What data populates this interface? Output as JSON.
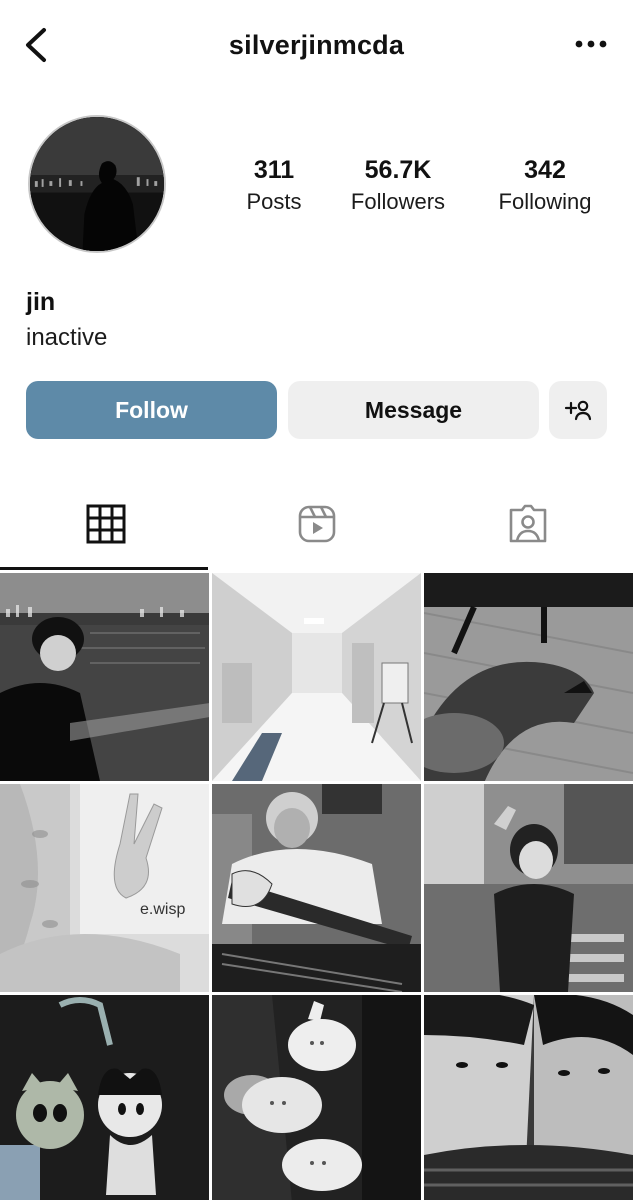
{
  "header": {
    "username": "silverjinmcda",
    "back_icon": "chevron-left-icon",
    "more_icon": "more-horizontal-icon"
  },
  "profile": {
    "posts_count": "311",
    "posts_label": "Posts",
    "followers_count": "56.7K",
    "followers_label": "Followers",
    "following_count": "342",
    "following_label": "Following",
    "display_name": "jin",
    "bio": "inactive"
  },
  "actions": {
    "follow_label": "Follow",
    "message_label": "Message",
    "add_person_icon": "add-person-icon"
  },
  "tabs": [
    {
      "icon": "grid-icon",
      "active": true
    },
    {
      "icon": "reels-icon",
      "active": false
    },
    {
      "icon": "tagged-icon",
      "active": false
    }
  ],
  "colors": {
    "follow_button": "#5e8aa8",
    "secondary_button": "#efefef"
  },
  "grid": {
    "rows": 3,
    "columns": 3
  }
}
